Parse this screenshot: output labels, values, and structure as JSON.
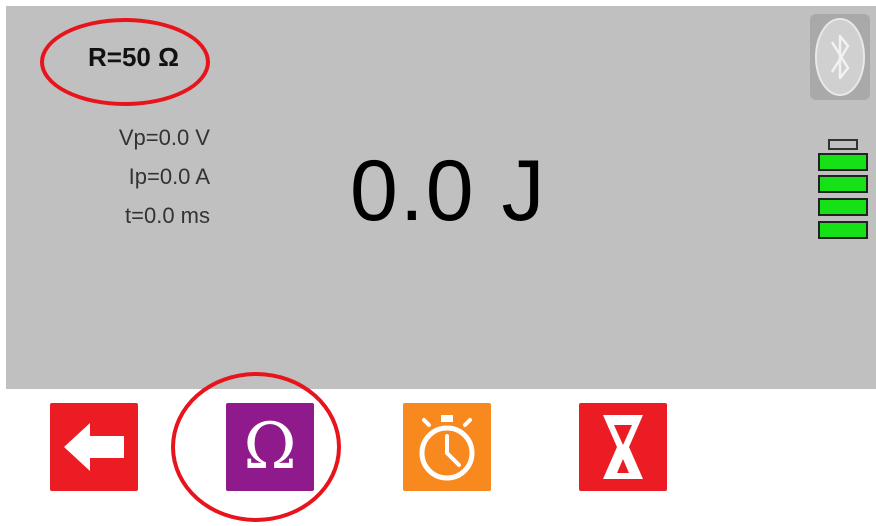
{
  "status": {
    "resistance": "R=50 Ω",
    "voltage": "Vp=0.0 V",
    "current": "Ip=0.0 A",
    "time": "t=0.0 ms",
    "energy": "0.0 J"
  },
  "indicators": {
    "connection_icon": "bluetooth-icon",
    "battery_level": 1.0,
    "battery_color": "#16e016"
  },
  "toolbar": {
    "back_icon": "arrow-left-icon",
    "resistance_label": "Ω",
    "timer_icon": "stopwatch-icon",
    "hourglass_icon": "hourglass-icon"
  },
  "colors": {
    "display_bg": "#c0c0c0",
    "red": "#ec1c24",
    "purple": "#8e1a8c",
    "orange": "#f7891e",
    "highlight": "#e8141c"
  }
}
